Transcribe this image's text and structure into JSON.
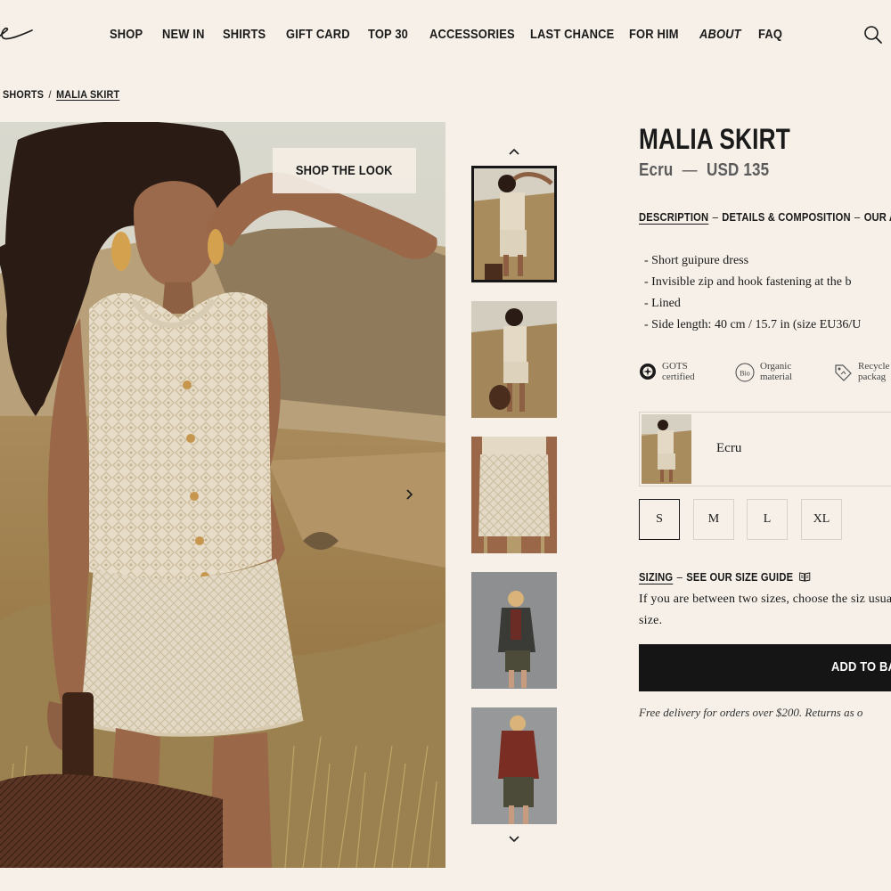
{
  "header": {
    "logo_name": "logo",
    "nav": [
      {
        "label": "SHOP"
      },
      {
        "label": "NEW IN"
      },
      {
        "label": "SHIRTS"
      },
      {
        "label": "GIFT CARD"
      },
      {
        "label": "TOP 30"
      },
      {
        "label": "ACCESSORIES"
      },
      {
        "label": "LAST CHANCE"
      },
      {
        "label": "FOR HIM"
      },
      {
        "label": "ABOUT"
      },
      {
        "label": "FAQ"
      }
    ],
    "search_icon": "search-icon"
  },
  "breadcrumb": {
    "parent": "SHORTS",
    "separator": "/",
    "current": "MALIA SKIRT"
  },
  "gallery": {
    "shop_the_look": "SHOP THE LOOK",
    "next_icon": "chevron-right-icon",
    "thumb_up_icon": "chevron-up-icon",
    "thumb_down_icon": "chevron-down-icon",
    "active_thumbnail": 1,
    "thumbnail_count": 5
  },
  "product": {
    "title": "MALIA SKIRT",
    "color": "Ecru",
    "dash": "—",
    "price": "USD 135",
    "tabs": [
      {
        "label": "DESCRIPTION",
        "active": true
      },
      {
        "label": "DETAILS & COMPOSITION",
        "active": false
      },
      {
        "label": "OUR A",
        "active": false
      }
    ],
    "tab_separator": "–",
    "description": [
      "Short guipure dress",
      "Invisible zip and hook fastening at the b",
      "Lined",
      "Side length: 40 cm / 15.7 in (size EU36/U"
    ],
    "badges": [
      {
        "icon": "gots-icon",
        "line1": "GOTS",
        "line2": "certified"
      },
      {
        "icon": "bio-icon",
        "icon_text": "Bio",
        "line1": "Organic",
        "line2": "material"
      },
      {
        "icon": "recycle-tag-icon",
        "line1": "Recycle",
        "line2": "packag"
      }
    ],
    "color_option": {
      "label": "Ecru",
      "selected": true
    },
    "sizes": [
      {
        "label": "S",
        "selected": true
      },
      {
        "label": "M",
        "selected": false
      },
      {
        "label": "L",
        "selected": false
      },
      {
        "label": "XL",
        "selected": false
      }
    ],
    "sizing": {
      "label": "SIZING",
      "separator": "–",
      "guide": "SEE OUR SIZE GUIDE",
      "guide_icon": "book-icon",
      "text": "If you are between two sizes, choose the siz usual size."
    },
    "add_to_bag": "ADD TO BA",
    "delivery": "Free delivery for orders over $200. Returns as o"
  },
  "colors": {
    "background": "#f6f0e8",
    "text": "#1a1a1a",
    "muted": "#5b5b5b",
    "button_bg": "#151515",
    "border": "#d9d2c8"
  }
}
